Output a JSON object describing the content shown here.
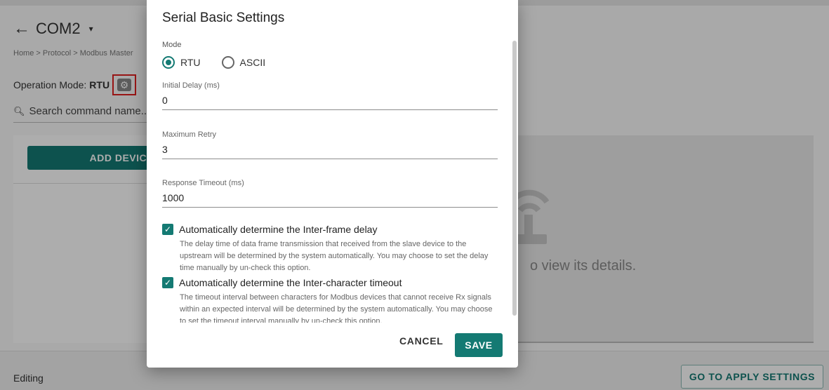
{
  "page": {
    "back_icon": "arrow-left-icon",
    "title": "COM2",
    "title_caret": "▾",
    "breadcrumb": "Home > Protocol > Modbus Master",
    "operation_mode_label": "Operation Mode:",
    "operation_mode_value": "RTU",
    "settings_icon": "gear-icon",
    "search_placeholder": "Search command name..",
    "add_device_label": "ADD DEVICE",
    "empty_message": "o view its details.",
    "status_text": "Editing",
    "apply_button_label": "GO TO APPLY SETTINGS"
  },
  "dialog": {
    "title": "Serial Basic Settings",
    "mode": {
      "label": "Mode",
      "options": [
        "RTU",
        "ASCII"
      ],
      "selected": "RTU"
    },
    "initial_delay": {
      "label": "Initial Delay (ms)",
      "value": "0"
    },
    "max_retry": {
      "label": "Maximum Retry",
      "value": "3"
    },
    "response_timeout": {
      "label": "Response Timeout (ms)",
      "value": "1000"
    },
    "interframe": {
      "label": "Automatically determine the Inter-frame delay",
      "checked": true,
      "description": "The delay time of data frame transmission that received from the slave device to the upstream will be determined by the system automatically. You may choose to set the delay time manually by un-check this option."
    },
    "interchar": {
      "label": "Automatically determine the Inter-character timeout",
      "checked": true,
      "description": "The timeout interval between characters for Modbus devices that cannot receive Rx signals within an expected interval will be determined by the system automatically. You may choose to set the timeout interval manually by un-check this option."
    },
    "cancel_label": "CANCEL",
    "save_label": "SAVE"
  },
  "colors": {
    "accent": "#147a73",
    "highlight_box": "#e02020"
  }
}
